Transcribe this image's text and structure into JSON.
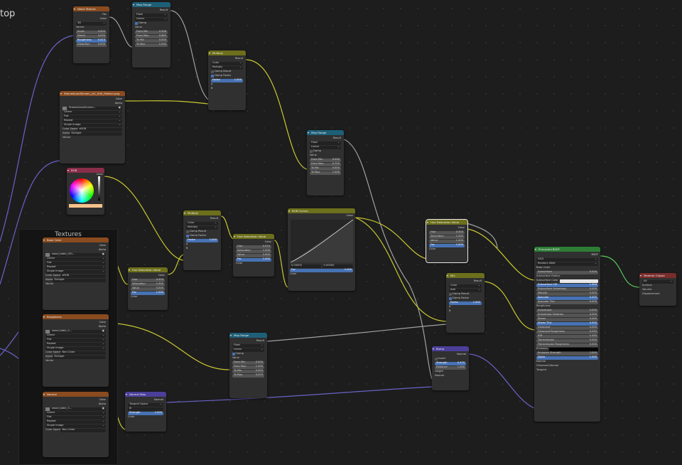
{
  "editor": {
    "breadcrumb": "top"
  },
  "frame": {
    "title": "Textures"
  },
  "nodes": {
    "noise": {
      "title": "Noise Texture",
      "out": [
        "Fac",
        "Color"
      ],
      "mode": "3D",
      "vector": "Vector",
      "fields": [
        [
          "Scale",
          "4.000"
        ],
        [
          "Detail",
          "4.000"
        ],
        [
          "Roughness",
          "0.413"
        ],
        [
          "Distortion",
          "0.000"
        ]
      ]
    },
    "maprange1": {
      "title": "Map Range",
      "out": "Result",
      "type": "Float",
      "interp": "Linear",
      "clamp": "Clamp",
      "value": "Value",
      "fields": [
        [
          "From Min",
          "0.356"
        ],
        [
          "From Max",
          "0.662"
        ],
        [
          "To Min",
          "0.000"
        ],
        [
          "To Max",
          "1.000"
        ]
      ]
    },
    "mult1": {
      "title": "Multiply",
      "out": "Result",
      "color": "Color",
      "blend": "Multiply",
      "clamp_result": "Clamp Result",
      "clamp_factor": "Clamp Factor",
      "factor": [
        "Factor",
        "1.000"
      ],
      "a": "A",
      "b": "B"
    },
    "img1": {
      "title": "StainedLandScreen_LtC_Stitl_Pattern.png",
      "out": [
        "Color",
        "Alpha"
      ],
      "file": "StainedLandScreen...",
      "interp": "Linear",
      "proj": "Flat",
      "ext": "Repeat",
      "src": "Single Image",
      "cs_label": "Color Space",
      "cs": "sRGB",
      "alpha_label": "Alpha",
      "alpha": "Straight",
      "vector": "Vector"
    },
    "maprange2": {
      "title": "Map Range",
      "out": "Result",
      "type": "Float",
      "interp": "Linear",
      "clamp": "Clamp",
      "value": "Value",
      "fields": [
        [
          "From Min",
          "0.000"
        ],
        [
          "From Max",
          "0.700"
        ],
        [
          "To Min",
          "0.000"
        ],
        [
          "To Max",
          "1.000"
        ]
      ]
    },
    "rgb": {
      "title": "RGB",
      "out": "Color"
    },
    "mult2": {
      "title": "Multiply",
      "out": "Result",
      "color": "Color",
      "blend": "Multiply",
      "clamp_result": "Clamp Result",
      "clamp_factor": "Clamp Factor",
      "factor": [
        "Factor",
        "1.000"
      ],
      "a": "A",
      "b": "B"
    },
    "hsv1": {
      "title": "Hue Saturation Value",
      "out": "Color",
      "fields": [
        [
          "Hue",
          "0.500"
        ],
        [
          "Saturation",
          "1.000"
        ],
        [
          "Value",
          "0.500"
        ],
        [
          "Fac",
          "1.000"
        ]
      ],
      "color": "Color"
    },
    "hsv2": {
      "title": "Hue Saturation Value",
      "out": "Color",
      "fields": [
        [
          "Hue",
          "0.510"
        ],
        [
          "Saturation",
          "1.000"
        ],
        [
          "Value",
          "2.000"
        ],
        [
          "Fac",
          "1.000"
        ]
      ],
      "color": "Color"
    },
    "curves": {
      "title": "RGB Curves",
      "out": "Color",
      "pt": [
        "0.00000",
        "0.00000"
      ],
      "fac": [
        "Fac",
        "1.000"
      ],
      "color": "Color"
    },
    "hsv3": {
      "title": "Hue Saturation Value",
      "out": "Color",
      "fields": [
        [
          "Hue",
          "0.500"
        ],
        [
          "Saturation",
          "1.000"
        ],
        [
          "Value",
          "1.000"
        ],
        [
          "Fac",
          "1.000"
        ]
      ],
      "color": "Color"
    },
    "mix": {
      "title": "Mix",
      "out": "Result",
      "color": "Color",
      "blend": "Add",
      "clamp_result": "Clamp Result",
      "clamp_factor": "Clamp Factor",
      "factor": [
        "Factor",
        "1.000"
      ],
      "a": "A",
      "b": "B"
    },
    "bump": {
      "title": "Bump",
      "out": "Normal",
      "invert": "Invert",
      "fields": [
        [
          "Strength",
          "0.370"
        ],
        [
          "Distance",
          "1.000"
        ]
      ],
      "height": "Height",
      "normal": "Normal"
    },
    "maprange3": {
      "title": "Map Range",
      "out": "Result",
      "type": "Float",
      "interp": "Linear",
      "clamp": "Clamp",
      "value": "Value",
      "fields": [
        [
          "From Min",
          "0.000"
        ],
        [
          "From Max",
          "1.000"
        ],
        [
          "To Min",
          "0.000"
        ],
        [
          "To Max",
          "0.379"
        ]
      ]
    },
    "bsdf": {
      "title": "Principled BSDF",
      "out": "BSDF",
      "dist": "GGX",
      "sss": "Random Walk",
      "base": "Base Color",
      "rows": [
        [
          "Subsurface",
          "0.000"
        ],
        [
          "Subsurface Radius",
          ""
        ],
        [
          "Subsurface Color",
          ""
        ],
        [
          "Subsurface IOR",
          "1.400"
        ],
        [
          "Subsurface Anisotropy",
          "0.000"
        ],
        [
          "Metallic",
          "0.000"
        ],
        [
          "Specular",
          "0.500"
        ],
        [
          "Specular Tint",
          "0.000"
        ]
      ],
      "rough": "Roughness",
      "rows2": [
        [
          "Anisotropic",
          "0.000"
        ],
        [
          "Anisotropic Rotation",
          "0.000"
        ],
        [
          "Sheen",
          "0.000"
        ],
        [
          "Sheen Tint",
          "0.500"
        ],
        [
          "Clearcoat",
          "0.000"
        ],
        [
          "Clearcoat Roughness",
          "0.030"
        ],
        [
          "IOR",
          "1.450"
        ],
        [
          "Transmission",
          "0.000"
        ],
        [
          "Transmission Roughness",
          "0.000"
        ]
      ],
      "emission": "Emission",
      "emission_strength": [
        "Emission Strength",
        "1.000"
      ],
      "alpha": [
        "Alpha",
        "1.000"
      ],
      "sockets": [
        "Normal",
        "Clearcoat Normal",
        "Tangent"
      ]
    },
    "output": {
      "title": "Material Output",
      "target": "All",
      "sockets": [
        "Surface",
        "Volume",
        "Displacement"
      ]
    },
    "tex_base": {
      "title": "Base Color",
      "out": [
        "Color",
        "Alpha"
      ],
      "file": "wood_table_001...",
      "interp": "Linear",
      "proj": "Flat",
      "ext": "Repeat",
      "src": "Single Image",
      "cs_label": "Color Space",
      "cs": "sRGB",
      "alpha_label": "Alpha",
      "alpha": "Straight",
      "vector": "Vector"
    },
    "tex_rough": {
      "title": "Roughness",
      "out": [
        "Color",
        "Alpha"
      ],
      "file": "wood_table_0...",
      "interp": "Linear",
      "proj": "Flat",
      "ext": "Repeat",
      "src": "Single Image",
      "cs_label": "Color Space",
      "cs": "Non-Color",
      "alpha_label": "Alpha",
      "alpha": "Straight",
      "vector": "Vector"
    },
    "tex_normal": {
      "title": "Normal",
      "out": [
        "Color",
        "Alpha"
      ],
      "file": "wood_table_0...",
      "interp": "Linear",
      "proj": "Flat",
      "ext": "Repeat",
      "src": "Single Image",
      "cs_label": "Color Space",
      "cs": "Non-Color"
    },
    "normalmap": {
      "title": "Normal Map",
      "out": "Normal",
      "space": "Tangent Space",
      "strength": [
        "Strength",
        "1.000"
      ],
      "color": "Color"
    }
  },
  "colors": {
    "link_yellow": "#c8c832",
    "link_purple": "#6a62c8",
    "link_gray": "#a0a0a0",
    "link_green": "#5ac85a"
  }
}
